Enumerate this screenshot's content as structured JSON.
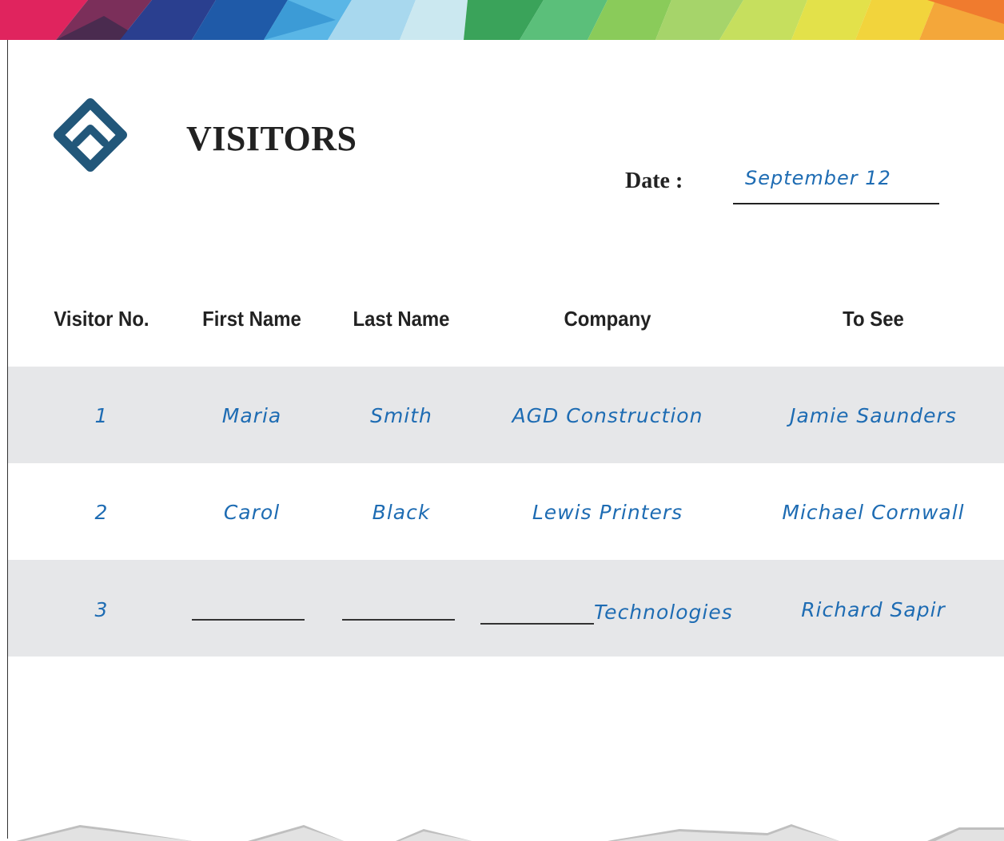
{
  "form": {
    "title": "VISITORS",
    "date_label": "Date :",
    "date_value": "September 12"
  },
  "table": {
    "headers": [
      "Visitor No.",
      "First Name",
      "Last Name",
      "Company",
      "To See"
    ],
    "rows": [
      {
        "no": "1",
        "first": "Maria",
        "last": "Smith",
        "company": "AGD Construction",
        "to_see": "Jamie Saunders"
      },
      {
        "no": "2",
        "first": "Carol",
        "last": "Black",
        "company": "Lewis Printers",
        "to_see": "Michael Cornwall"
      },
      {
        "no": "3",
        "first": "",
        "last": "",
        "company": "Technologies",
        "to_see": "Richard Sapir"
      }
    ]
  },
  "colors": {
    "handwriting": "#1e6cb3",
    "row_shade": "#e6e7e9",
    "logo": "#22577a"
  },
  "icons": {
    "logo": "diamond-chevron-logo"
  }
}
